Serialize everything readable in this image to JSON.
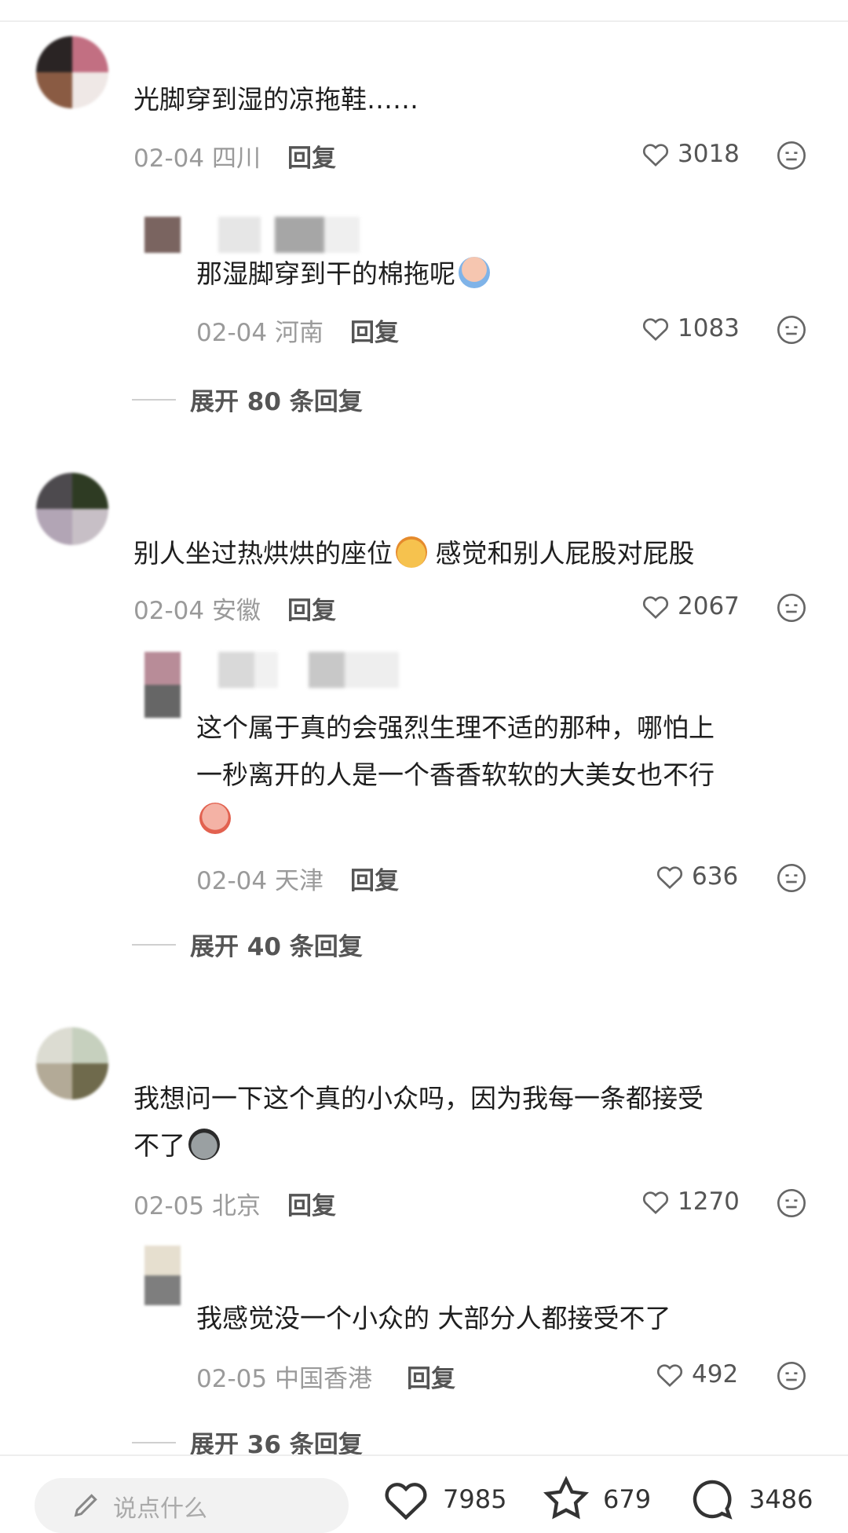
{
  "comments": [
    {
      "text": "光脚穿到湿的凉拖鞋……",
      "date": "02-04",
      "location": "四川",
      "reply_label": "回复",
      "likes": "3018",
      "replies": [
        {
          "text": "那湿脚穿到干的棉拖呢",
          "date": "02-04",
          "location": "河南",
          "reply_label": "回复",
          "likes": "1083"
        }
      ],
      "expand_label": "展开 80 条回复"
    },
    {
      "text_a": "别人坐过热烘烘的座位",
      "text_b": " 感觉和别人屁股对屁股",
      "date": "02-04",
      "location": "安徽",
      "reply_label": "回复",
      "likes": "2067",
      "replies": [
        {
          "line1": "这个属于真的会强烈生理不适的那种，哪怕上",
          "line2": "一秒离开的人是一个香香软软的大美女也不行",
          "date": "02-04",
          "location": "天津",
          "reply_label": "回复",
          "likes": "636"
        }
      ],
      "expand_label": "展开 40 条回复"
    },
    {
      "line1": "我想问一下这个真的小众吗，因为我每一条都接受",
      "line2": "不了",
      "date": "02-05",
      "location": "北京",
      "reply_label": "回复",
      "likes": "1270",
      "replies": [
        {
          "text": "我感觉没一个小众的 大部分人都接受不了",
          "date": "02-05",
          "location": "中国香港",
          "reply_label": "回复",
          "likes": "492"
        }
      ],
      "expand_label": "展开 36 条回复"
    }
  ],
  "bottom_bar": {
    "input_placeholder": "说点什么",
    "likes": "7985",
    "favorites": "679",
    "comments": "3486"
  }
}
